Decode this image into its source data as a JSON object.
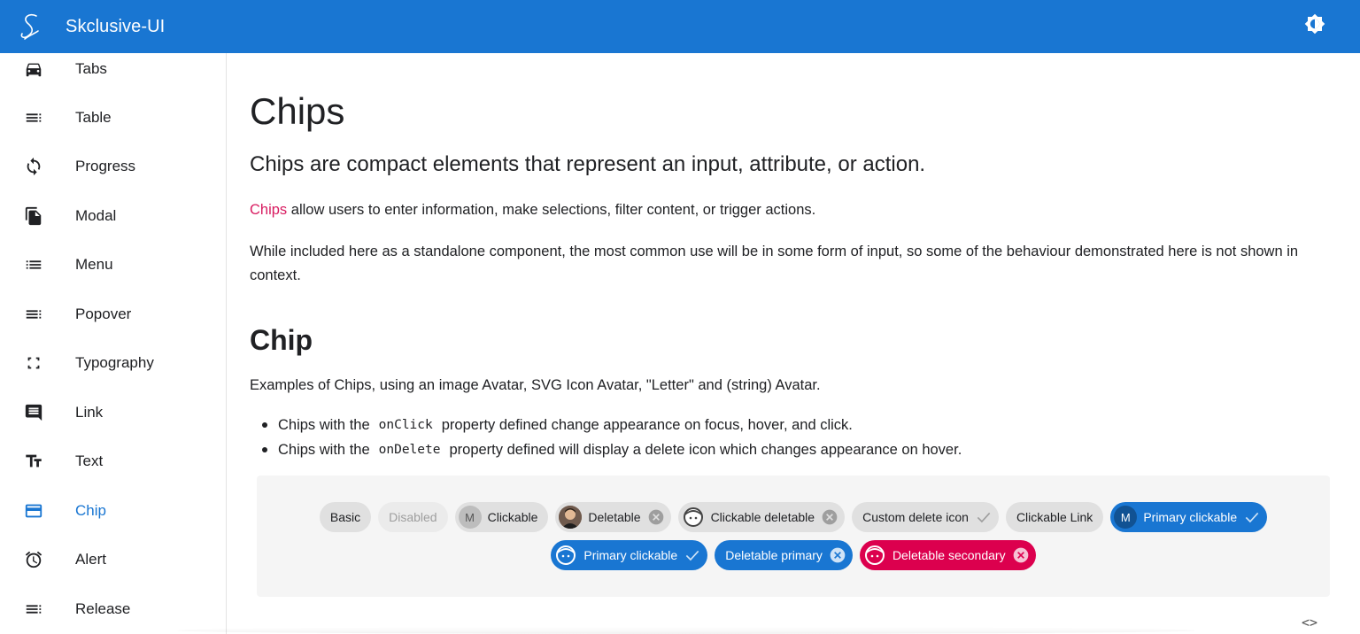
{
  "app": {
    "title": "Skclusive-UI",
    "accent_color": "#1976d2",
    "logo_icon": "script-s-logo",
    "theme_toggle_icon": "brightness-icon"
  },
  "sidebar": {
    "items": [
      {
        "label": "Tabs",
        "icon": "car-icon",
        "active": false
      },
      {
        "label": "Table",
        "icon": "table-lines-icon",
        "active": false
      },
      {
        "label": "Progress",
        "icon": "refresh-icon",
        "active": false
      },
      {
        "label": "Modal",
        "icon": "file-copy-icon",
        "active": false
      },
      {
        "label": "Menu",
        "icon": "list-icon",
        "active": false
      },
      {
        "label": "Popover",
        "icon": "popover-lines-icon",
        "active": false
      },
      {
        "label": "Typography",
        "icon": "fullscreen-corners-icon",
        "active": false
      },
      {
        "label": "Link",
        "icon": "comment-icon",
        "active": false
      },
      {
        "label": "Text",
        "icon": "text-fields-icon",
        "active": false
      },
      {
        "label": "Chip",
        "icon": "card-icon",
        "active": true
      },
      {
        "label": "Alert",
        "icon": "alarm-icon",
        "active": false
      },
      {
        "label": "Release",
        "icon": "release-lines-icon",
        "active": false
      }
    ]
  },
  "main": {
    "title": "Chips",
    "subtitle": "Chips are compact elements that represent an input, attribute, or action.",
    "para1_link": "Chips",
    "para1_rest": " allow users to enter information, make selections, filter content, or trigger actions.",
    "para2": "While included here as a standalone component, the most common use will be in some form of input, so some of the behaviour demonstrated here is not shown in context.",
    "section_title": "Chip",
    "section_desc": "Examples of Chips, using an image Avatar, SVG Icon Avatar, \"Letter\" and (string) Avatar.",
    "bullets": [
      {
        "pre": "Chips with the",
        "code": "onClick",
        "post": "property defined change appearance on focus, hover, and click."
      },
      {
        "pre": "Chips with the",
        "code": "onDelete",
        "post": "property defined will display a delete icon which changes appearance on hover."
      }
    ]
  },
  "chips": {
    "row1": [
      {
        "label": "Basic"
      },
      {
        "label": "Disabled"
      },
      {
        "label": "Clickable",
        "avatar_letter": "M"
      },
      {
        "label": "Deletable",
        "avatar": "photo"
      },
      {
        "label": "Clickable deletable",
        "avatar": "face-icon"
      },
      {
        "label": "Custom delete icon"
      },
      {
        "label": "Clickable Link"
      },
      {
        "label": "Primary clickable",
        "avatar_letter": "M"
      }
    ],
    "row2": [
      {
        "label": "Primary clickable",
        "avatar": "face-icon"
      },
      {
        "label": "Deletable primary"
      },
      {
        "label": "Deletable secondary",
        "avatar": "face-icon"
      }
    ],
    "colors": {
      "default": "#e0e0e0",
      "primary": "#1976d2",
      "secondary": "#dc004e"
    }
  },
  "code_toggle": "<>"
}
